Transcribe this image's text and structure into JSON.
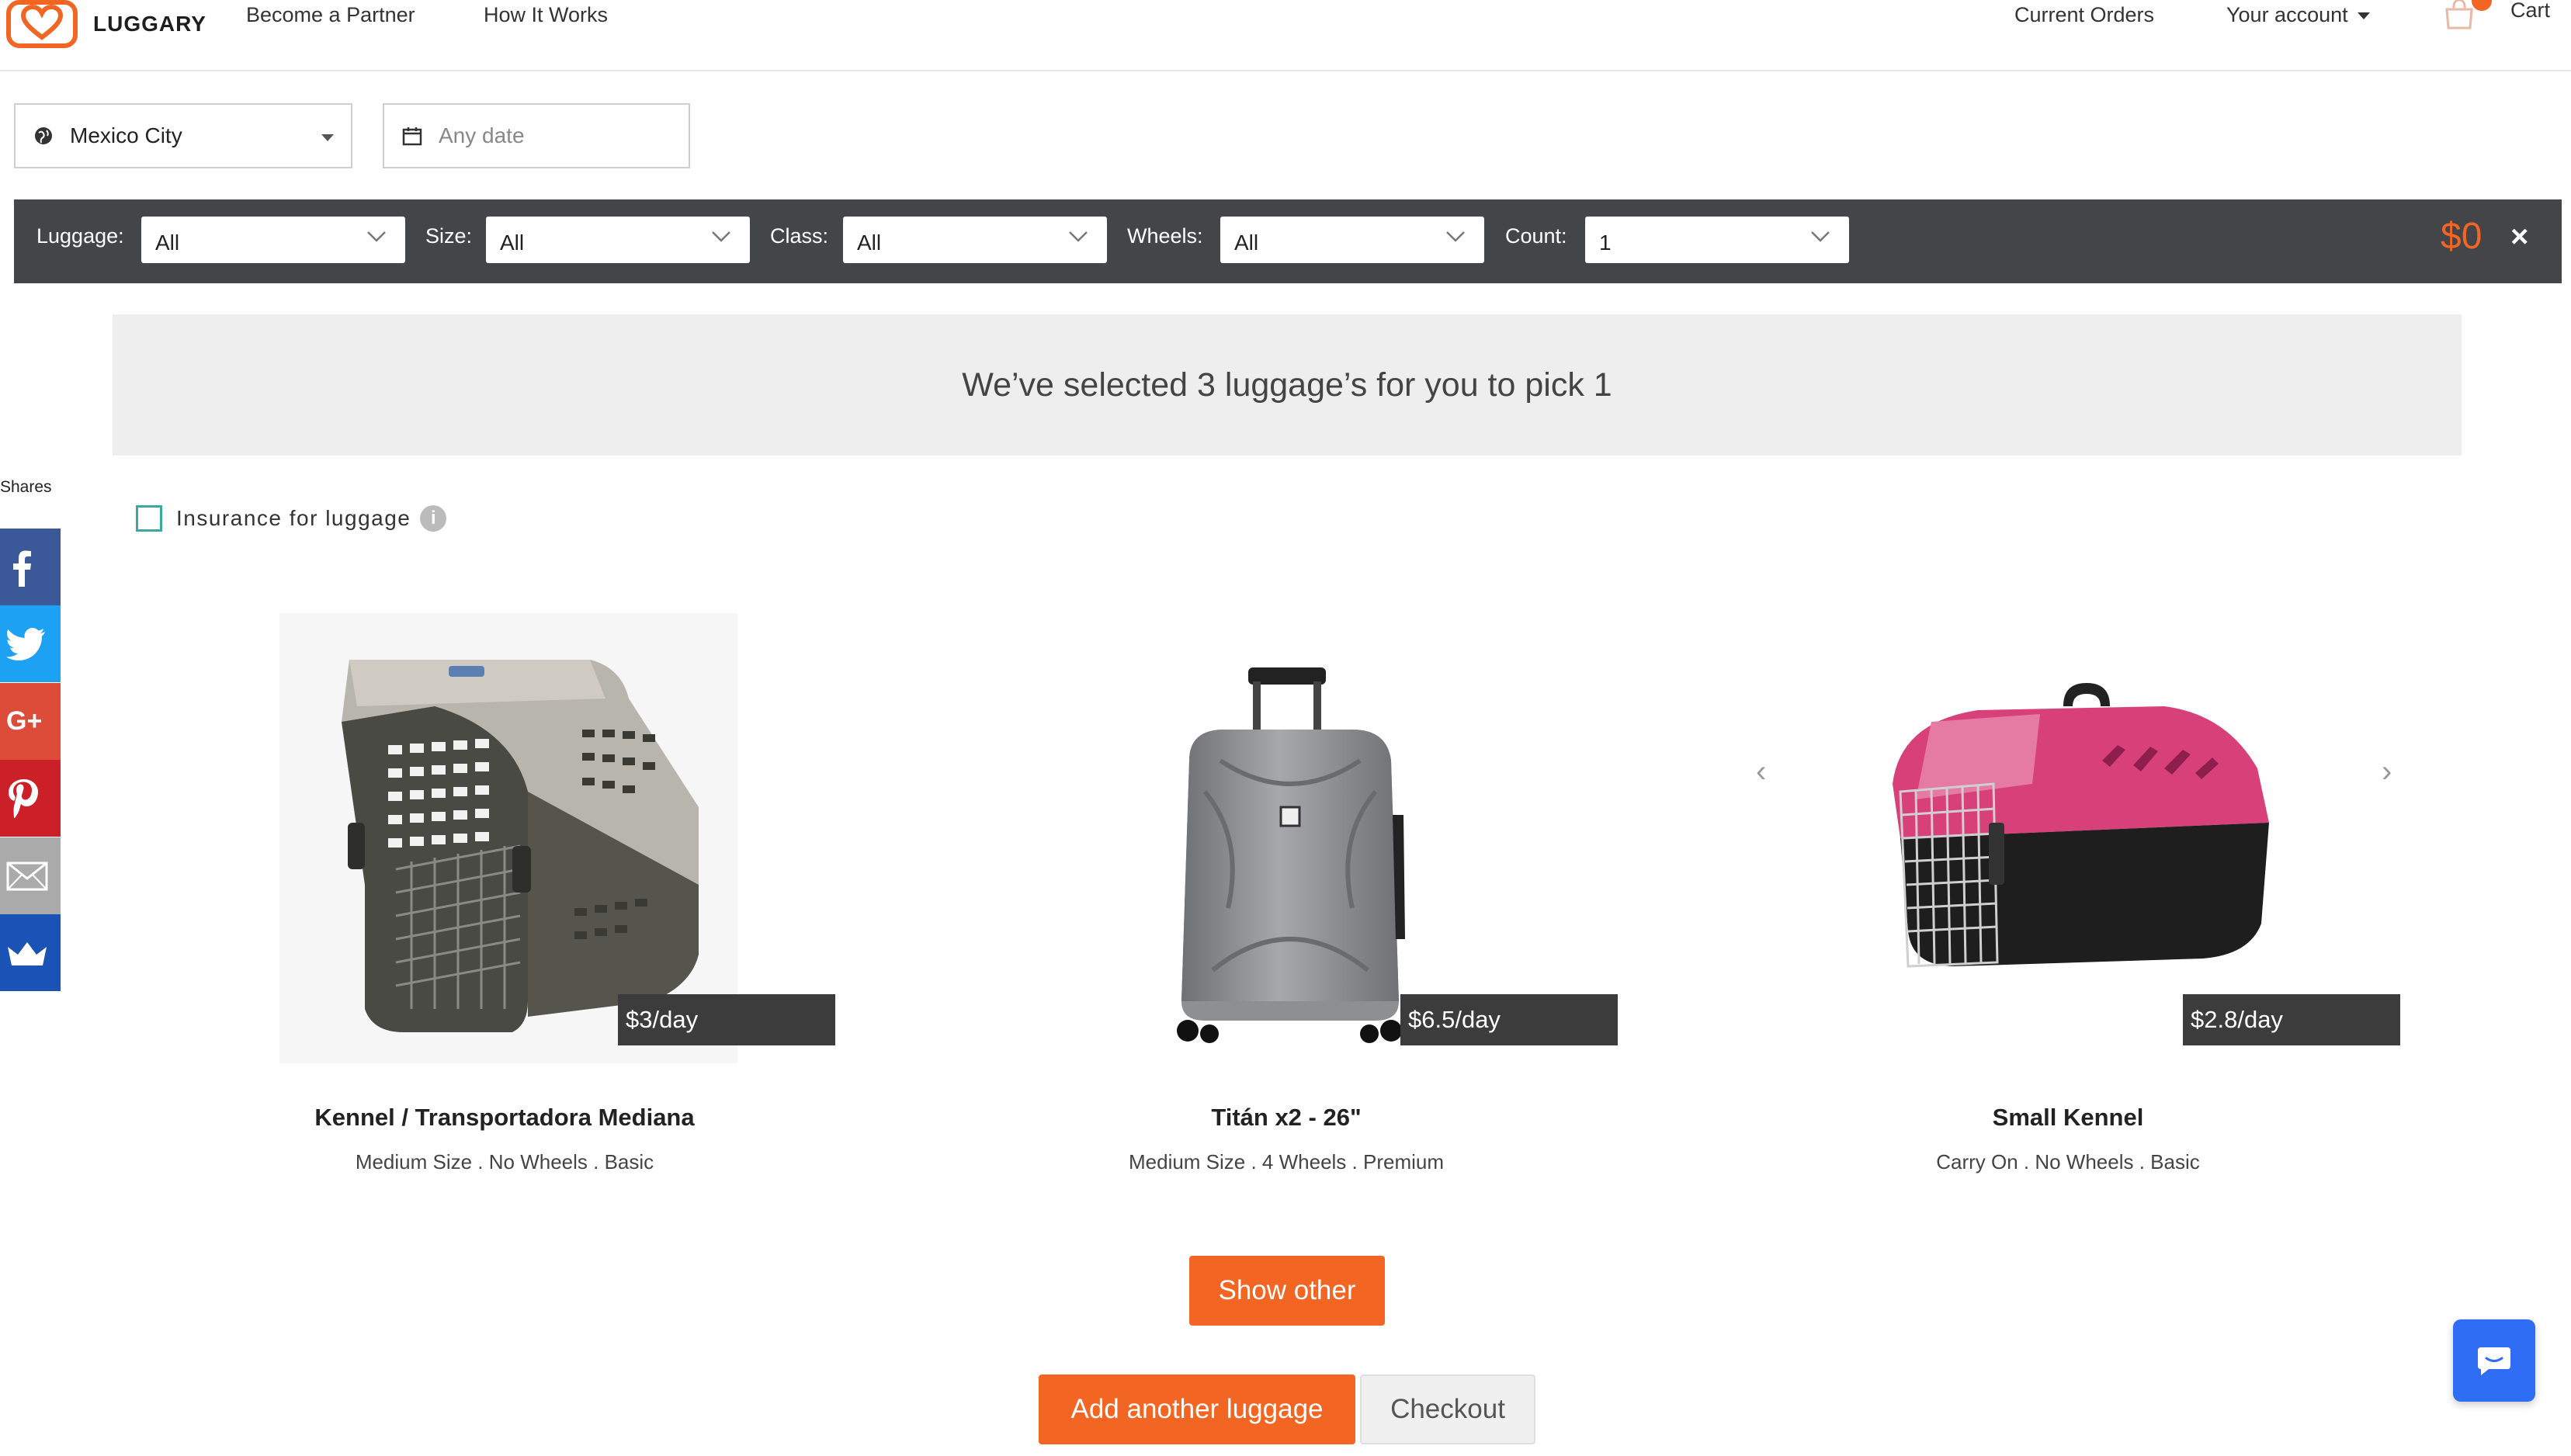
{
  "brand": {
    "name": "LUGGARY",
    "color": "#f26522"
  },
  "nav": {
    "become_partner": "Become a Partner",
    "how_it_works": "How It Works",
    "current_orders": "Current Orders",
    "your_account": "Your account",
    "cart": "Cart"
  },
  "search": {
    "city": "Mexico City",
    "date_placeholder": "Any date"
  },
  "filters": {
    "luggage_label": "Luggage:",
    "luggage_value": "All",
    "size_label": "Size:",
    "size_value": "All",
    "class_label": "Class:",
    "class_value": "All",
    "wheels_label": "Wheels:",
    "wheels_value": "All",
    "count_label": "Count:",
    "count_value": "1",
    "total": "$0",
    "close": "×"
  },
  "banner": {
    "text": "We’ve selected 3 luggage’s for you to pick 1"
  },
  "shares": {
    "label": "Shares"
  },
  "insurance": {
    "label": "Insurance for luggage",
    "checked": false
  },
  "products": [
    {
      "name": "Kennel / Transportadora Mediana",
      "meta": "Medium Size . No Wheels . Basic",
      "price": "$3/day"
    },
    {
      "name": "Titán x2 - 26\"",
      "meta": "Medium Size . 4 Wheels . Premium",
      "price": "$6.5/day"
    },
    {
      "name": "Small Kennel",
      "meta": "Carry On . No Wheels . Basic",
      "price": "$2.8/day"
    }
  ],
  "buttons": {
    "show_other": "Show other",
    "add_another": "Add another luggage",
    "checkout": "Checkout"
  }
}
